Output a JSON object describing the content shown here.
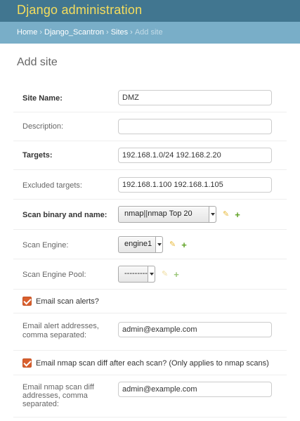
{
  "header": {
    "brand": "Django administration"
  },
  "breadcrumbs": {
    "home": "Home",
    "app": "Django_Scantron",
    "model": "Sites",
    "current": "Add site",
    "separator": "›"
  },
  "page": {
    "title": "Add site"
  },
  "form": {
    "site_name": {
      "label": "Site Name:",
      "value": "DMZ"
    },
    "description": {
      "label": "Description:",
      "value": ""
    },
    "targets": {
      "label": "Targets:",
      "value": "192.168.1.0/24 192.168.2.20"
    },
    "excluded_targets": {
      "label": "Excluded targets:",
      "value": "192.168.1.100 192.168.1.105"
    },
    "scan_binary": {
      "label": "Scan binary and name:",
      "selected": "nmap||nmap Top 20"
    },
    "scan_engine": {
      "label": "Scan Engine:",
      "selected": "engine1"
    },
    "scan_engine_pool": {
      "label": "Scan Engine Pool:",
      "selected": "---------"
    },
    "email_scan_alerts": {
      "label": "Email scan alerts?",
      "checked": true
    },
    "email_alert_addresses": {
      "label_line1": "Email alert addresses,",
      "label_line2": "comma separated:",
      "value": "admin@example.com"
    },
    "email_nmap_diff": {
      "label": "Email nmap scan diff after each scan? (Only applies to nmap scans)",
      "checked": true
    },
    "email_nmap_diff_addresses": {
      "label_line1": "Email nmap scan diff",
      "label_line2": "addresses, comma",
      "label_line3": "separated:",
      "value": "admin@example.com"
    }
  },
  "icons": {
    "edit": "pencil-icon",
    "add": "plus-icon"
  },
  "colors": {
    "header": "#417690",
    "breadcrumbs": "#79aec8",
    "brand": "#f5dd5d",
    "checkbox": "#d95f2d",
    "add": "#5fa225",
    "edit": "#e8b93a"
  }
}
